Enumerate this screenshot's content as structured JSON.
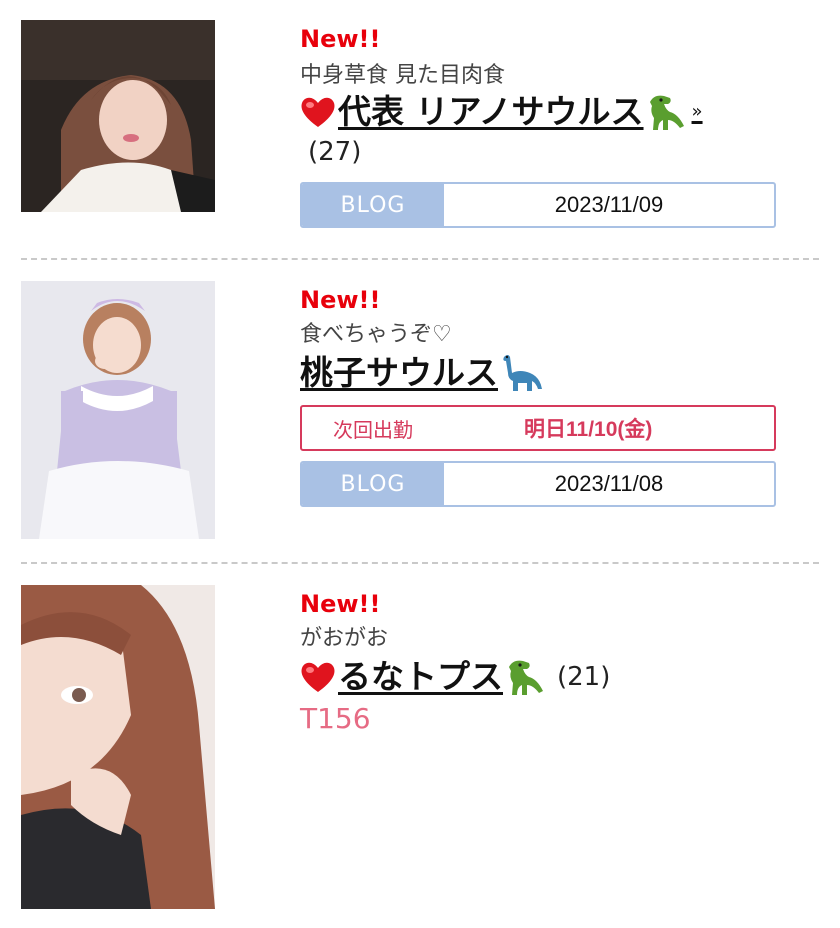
{
  "cast_list": [
    {
      "new_label": "New!!",
      "catchphrase": "中身草食 見た目肉食",
      "name": "代表 リアノサウルス",
      "has_heart": true,
      "dino_icon": "t-rex-icon",
      "trailing_mark": "»",
      "count": "(27)",
      "blog_label": "BLOG",
      "blog_date": "2023/11/09"
    },
    {
      "new_label": "New!!",
      "catchphrase": "食べちゃうぞ♡",
      "name": "桃子サウルス",
      "has_heart": false,
      "dino_icon": "sauropod-icon",
      "next_shift_label": "次回出勤",
      "next_shift_value": "明日11/10(金)",
      "blog_label": "BLOG",
      "blog_date": "2023/11/08"
    },
    {
      "new_label": "New!!",
      "catchphrase": "がおがお",
      "name": "るなトプス",
      "has_heart": true,
      "dino_icon": "t-rex-icon",
      "count": "(21)",
      "height": "T156"
    }
  ],
  "colors": {
    "new": "#e8000b",
    "blog_accent": "#a9c1e4",
    "next_shift_accent": "#d63a5c",
    "height_text": "#e66b84",
    "heart": "#e0141e",
    "dino_green": "#5a9e2f",
    "dino_blue": "#3f86b8"
  }
}
